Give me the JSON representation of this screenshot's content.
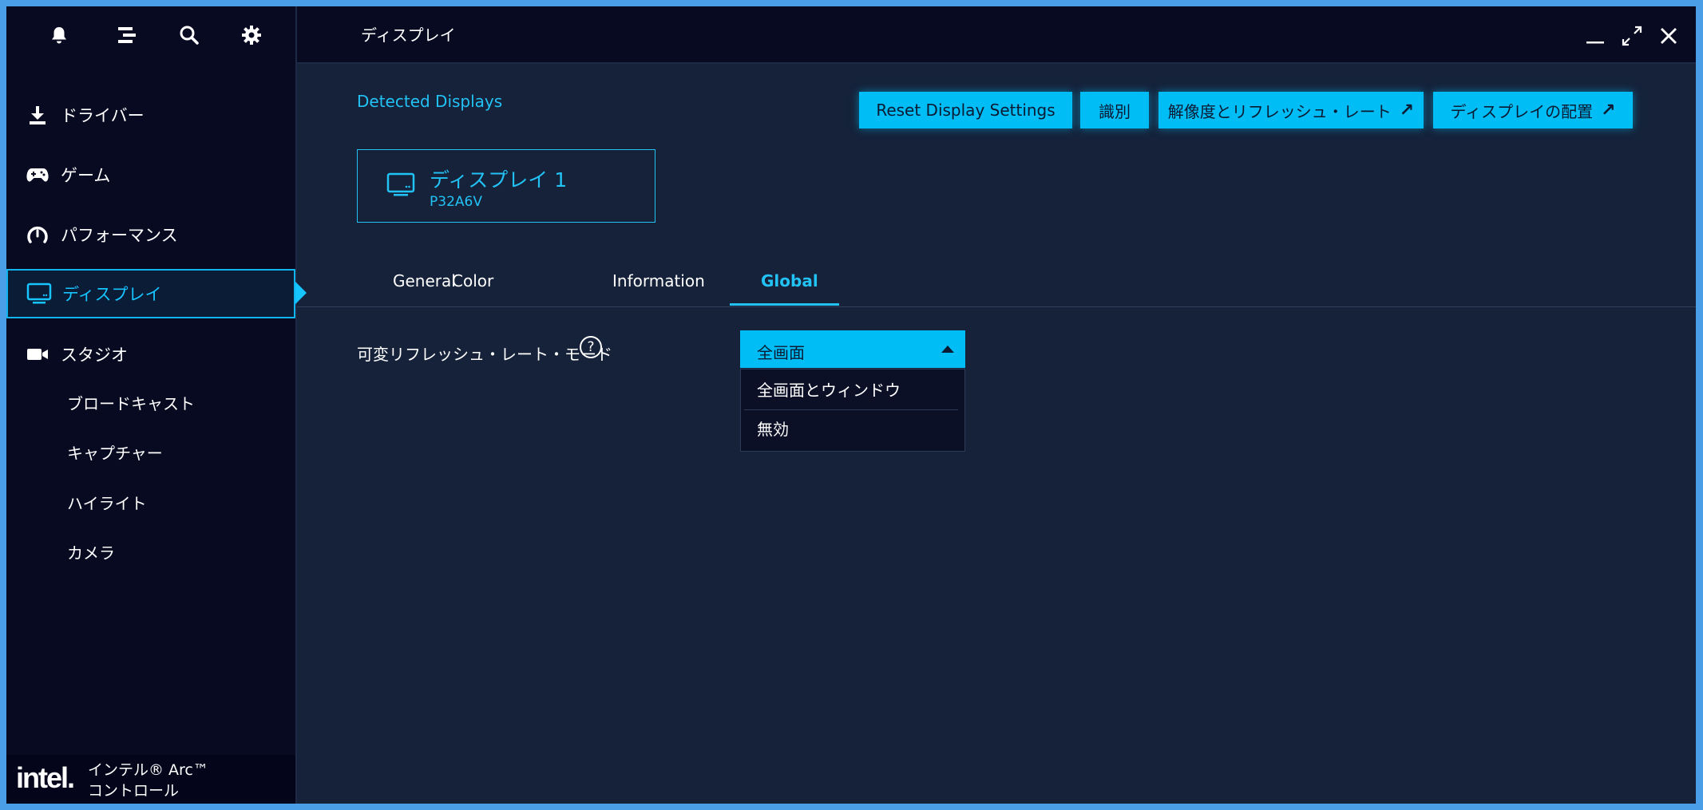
{
  "window": {
    "title": "ディスプレイ"
  },
  "sidebar": {
    "top_icons": [
      "bell-icon",
      "list-icon",
      "search-icon",
      "gear-icon"
    ],
    "items": [
      {
        "label": "ドライバー",
        "icon": "download-icon"
      },
      {
        "label": "ゲーム",
        "icon": "gamepad-icon"
      },
      {
        "label": "パフォーマンス",
        "icon": "gauge-icon"
      },
      {
        "label": "ディスプレイ",
        "icon": "monitor-icon",
        "active": true
      },
      {
        "label": "スタジオ",
        "icon": "video-camera-icon"
      }
    ],
    "sub_items": [
      "ブロードキャスト",
      "キャプチャー",
      "ハイライト",
      "カメラ"
    ],
    "brand": {
      "logo": "intel.",
      "line1": "インテル® Arc™",
      "line2": "コントロール"
    }
  },
  "main": {
    "detected_label": "Detected Displays",
    "buttons": {
      "reset": "Reset Display Settings",
      "identify": "識別",
      "resolution": "解像度とリフレッシュ・レート",
      "arrangement": "ディスプレイの配置",
      "external_arrow": "↗"
    },
    "display_card": {
      "name": "ディスプレイ 1",
      "model": "P32A6V"
    },
    "tabs": [
      "General",
      "Color",
      "Information",
      "Global"
    ],
    "active_tab": "Global",
    "vrr": {
      "label": "可変リフレッシュ・レート・モード",
      "help": "?",
      "selected": "全画面",
      "options": [
        "全画面とウィンドウ",
        "無効"
      ]
    }
  },
  "colors": {
    "accent": "#00bdf5",
    "background": "#15223a",
    "sidebar": "#080a22"
  }
}
